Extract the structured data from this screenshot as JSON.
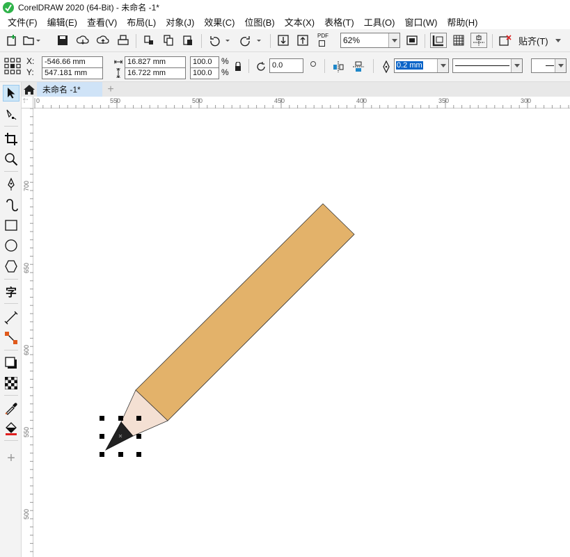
{
  "app": {
    "title": "CorelDRAW 2020 (64-Bit) - 未命名 -1*"
  },
  "menu": [
    {
      "label": "文件(F)"
    },
    {
      "label": "编辑(E)"
    },
    {
      "label": "查看(V)"
    },
    {
      "label": "布局(L)"
    },
    {
      "label": "对象(J)"
    },
    {
      "label": "效果(C)"
    },
    {
      "label": "位图(B)"
    },
    {
      "label": "文本(X)"
    },
    {
      "label": "表格(T)"
    },
    {
      "label": "工具(O)"
    },
    {
      "label": "窗口(W)"
    },
    {
      "label": "帮助(H)"
    }
  ],
  "toolbar": {
    "zoom": "62%",
    "snap_label": "贴齐(T)",
    "pdf_label": "PDF"
  },
  "props": {
    "x_label": "X:",
    "y_label": "Y:",
    "x_value": "-546.66 mm",
    "y_value": "547.181 mm",
    "w_value": "16.827 mm",
    "h_value": "16.722 mm",
    "scale_x": "100.0",
    "scale_y": "100.0",
    "percent": "%",
    "rotation": "0.0",
    "outline_width": "0.2 mm"
  },
  "tabs": {
    "doc": "未命名 -1*",
    "add": "+"
  },
  "rulers": {
    "h_labels": [
      "0",
      "550",
      "500",
      "450",
      "400",
      "350",
      "300"
    ],
    "v_labels": [
      "700",
      "650",
      "600",
      "550",
      "500"
    ]
  },
  "drawing": {
    "pencil_body_color": "#e3b26a",
    "pencil_wood_color": "#f4e0d3",
    "pencil_lead_color": "#222222"
  },
  "icons": {
    "toolbox": [
      "pick-tool-icon",
      "shape-tool-icon",
      "crop-tool-icon",
      "zoom-tool-icon",
      "freehand-tool-icon",
      "artistic-media-icon",
      "rectangle-tool-icon",
      "ellipse-tool-icon",
      "polygon-tool-icon",
      "text-tool-icon",
      "parallel-dimension-icon",
      "connector-tool-icon",
      "drop-shadow-icon",
      "transparency-icon",
      "eyedropper-icon",
      "interactive-fill-icon",
      "add-tool-icon"
    ]
  }
}
